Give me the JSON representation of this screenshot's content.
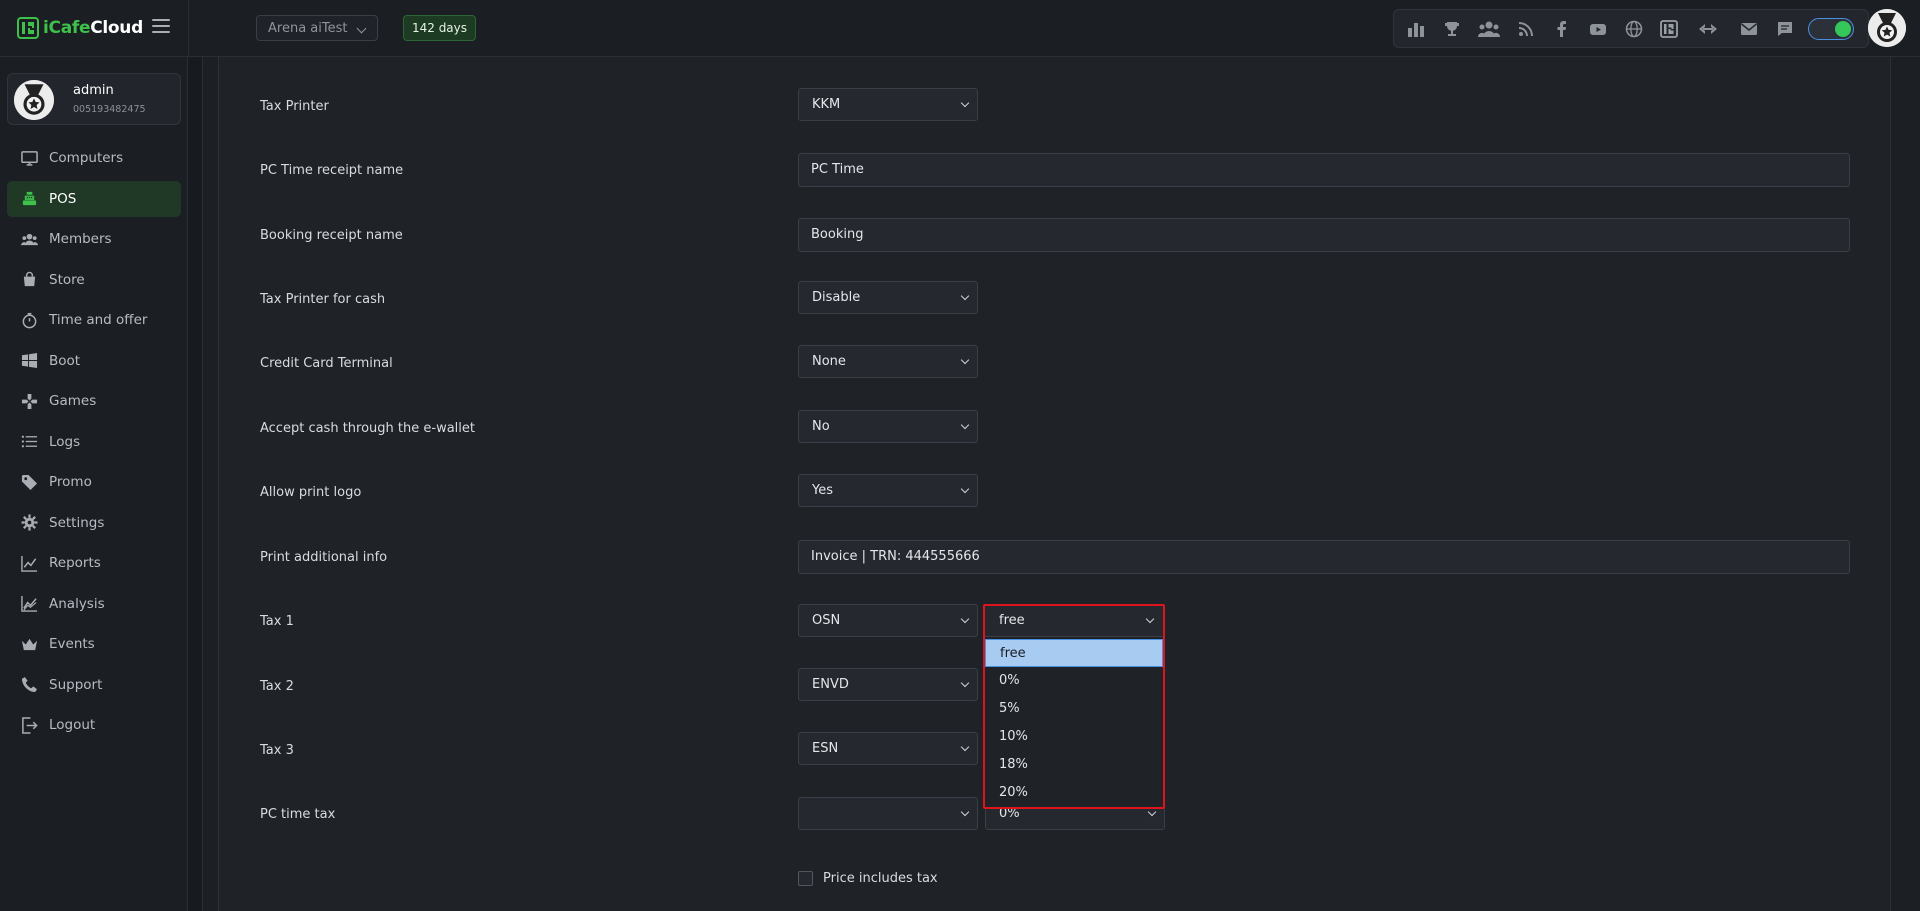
{
  "app": {
    "logo_prefix": "iCafe",
    "logo_suffix": "Cloud"
  },
  "topbar": {
    "cafe_name": "Arena aiTest",
    "days_badge": "142 days",
    "icons": [
      "leaderboard-icon",
      "trophy-icon",
      "group-icon",
      "rss-icon",
      "facebook-icon",
      "youtube-icon",
      "globe-icon",
      "icafe-icon",
      "double-chevron-icon",
      "mail-icon",
      "chat-icon"
    ],
    "toggle_on": true,
    "accent_color": "#34c759"
  },
  "user": {
    "name": "admin",
    "id": "005193482475"
  },
  "sidebar": {
    "items": [
      {
        "label": "Computers",
        "icon": "monitor-icon"
      },
      {
        "label": "POS",
        "icon": "cash-register-icon",
        "active": true
      },
      {
        "label": "Members",
        "icon": "members-icon"
      },
      {
        "label": "Store",
        "icon": "shopping-bag-icon"
      },
      {
        "label": "Time and offer",
        "icon": "stopwatch-icon"
      },
      {
        "label": "Boot",
        "icon": "windows-icon"
      },
      {
        "label": "Games",
        "icon": "gamepad-icon"
      },
      {
        "label": "Logs",
        "icon": "list-icon"
      },
      {
        "label": "Promo",
        "icon": "tag-icon"
      },
      {
        "label": "Settings",
        "icon": "gear-icon"
      },
      {
        "label": "Reports",
        "icon": "line-chart-icon"
      },
      {
        "label": "Analysis",
        "icon": "area-chart-icon"
      },
      {
        "label": "Events",
        "icon": "crown-icon"
      },
      {
        "label": "Support",
        "icon": "phone-icon"
      },
      {
        "label": "Logout",
        "icon": "logout-icon"
      }
    ]
  },
  "form": {
    "tax_printer": {
      "label": "Tax Printer",
      "value": "KKM"
    },
    "pc_time_receipt": {
      "label": "PC Time receipt name",
      "value": "PC Time"
    },
    "booking_receipt": {
      "label": "Booking receipt name",
      "value": "Booking"
    },
    "tax_printer_cash": {
      "label": "Tax Printer for cash",
      "value": "Disable"
    },
    "credit_card_terminal": {
      "label": "Credit Card Terminal",
      "value": "None"
    },
    "accept_cash_ewallet": {
      "label": "Accept cash through the e-wallet",
      "value": "No"
    },
    "allow_print_logo": {
      "label": "Allow print logo",
      "value": "Yes"
    },
    "print_additional_info": {
      "label": "Print additional info",
      "value": "Invoice | TRN: 444555666"
    },
    "tax1": {
      "label": "Tax 1",
      "system": "OSN",
      "rate": "free"
    },
    "tax2": {
      "label": "Tax 2",
      "system": "ENVD"
    },
    "tax3": {
      "label": "Tax 3",
      "system": "ESN"
    },
    "pc_time_tax": {
      "label": "PC time tax",
      "system": "",
      "rate": "0%"
    },
    "price_includes_tax": {
      "label": "Price includes tax",
      "checked": false
    }
  },
  "dropdown": {
    "open_for": "tax1.rate",
    "options": [
      "free",
      "0%",
      "5%",
      "10%",
      "18%",
      "20%"
    ],
    "selected": "free",
    "highlight_color": "#e0141c"
  }
}
